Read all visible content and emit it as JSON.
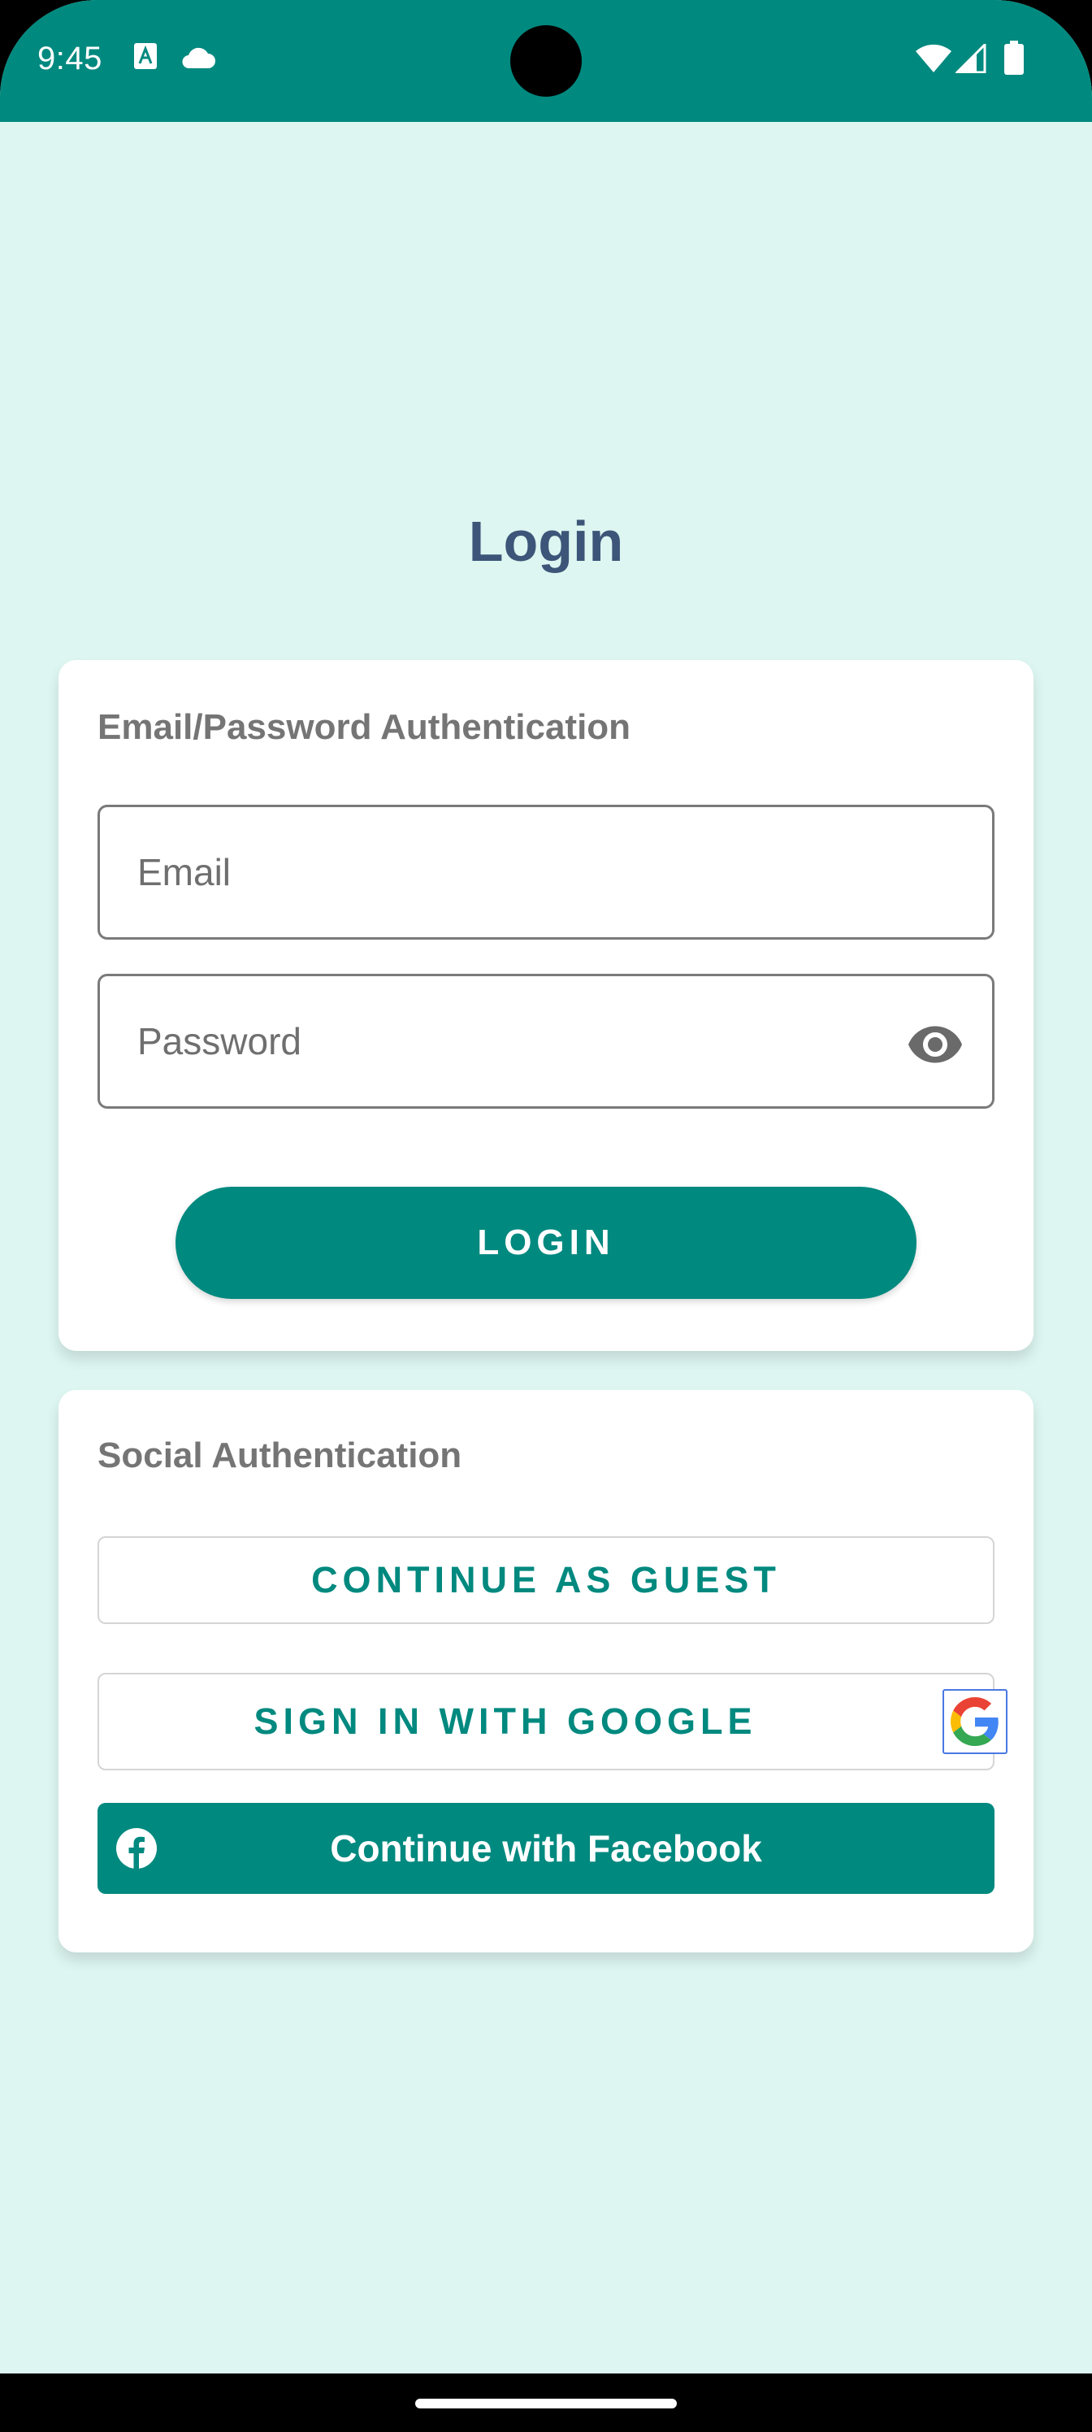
{
  "status_bar": {
    "time": "9:45",
    "left_icons": [
      "a-notification-icon",
      "cloud-icon"
    ],
    "right_icons": [
      "wifi-icon",
      "signal-icon",
      "battery-icon"
    ]
  },
  "page": {
    "title": "Login"
  },
  "email_card": {
    "heading": "Email/Password Authentication",
    "email_placeholder": "Email",
    "email_value": "",
    "password_placeholder": "Password",
    "password_value": "",
    "toggle_icon": "eye-icon",
    "login_label": "LOGIN"
  },
  "social_card": {
    "heading": "Social Authentication",
    "guest_label": "CONTINUE AS GUEST",
    "google_label": "SIGN IN WITH GOOGLE",
    "google_icon": "google-logo-icon",
    "facebook_label": "Continue with Facebook",
    "facebook_icon": "facebook-icon"
  },
  "colors": {
    "primary": "#00897F",
    "background": "#DDF6F1",
    "title": "#3C5578",
    "heading": "#757575"
  }
}
